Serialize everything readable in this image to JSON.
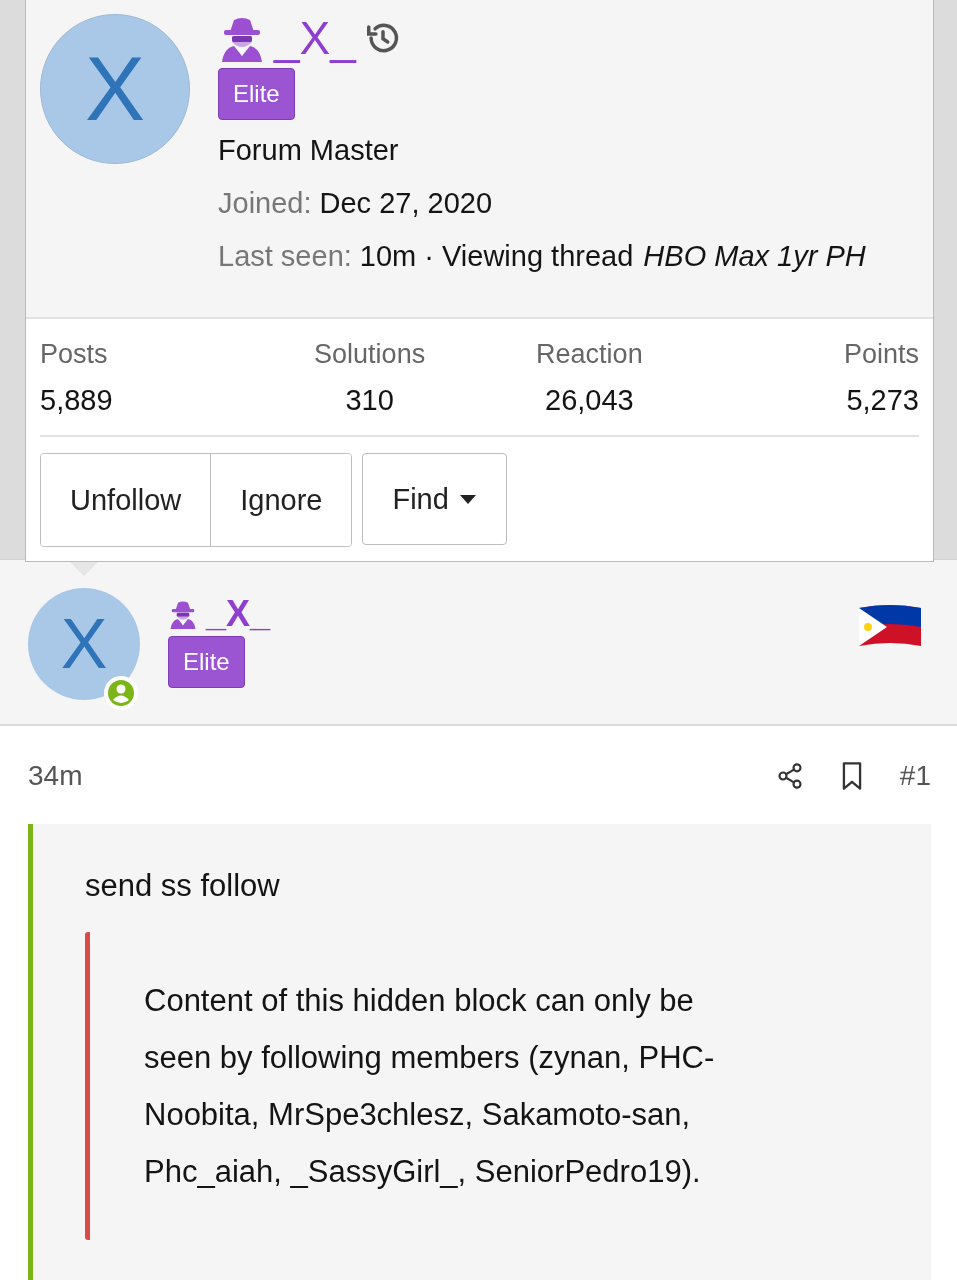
{
  "popup": {
    "avatar_letter": "X",
    "username": "_X_",
    "banner": "Elite",
    "user_title": "Forum Master",
    "joined": {
      "label": "Joined:",
      "value": "Dec 27, 2020"
    },
    "last_seen": {
      "label": "Last seen:",
      "value": "10m · Viewing thread",
      "thread": "HBO Max 1yr PH"
    },
    "stats": [
      {
        "label": "Posts",
        "value": "5,889"
      },
      {
        "label": "Solutions",
        "value": "310"
      },
      {
        "label": "Reaction",
        "value": "26,043"
      },
      {
        "label": "Points",
        "value": "5,273"
      }
    ],
    "buttons": [
      {
        "label": "Unfollow",
        "kind": "plain"
      },
      {
        "label": "Ignore",
        "kind": "plain"
      },
      {
        "label": "Find",
        "kind": "dropdown"
      }
    ]
  },
  "post": {
    "user": {
      "avatar_letter": "X",
      "username": "_X_",
      "banner": "Elite",
      "online": true
    },
    "time": "34m",
    "number": "#1",
    "message": "send ss follow",
    "hidden_block": "Content of this hidden block can only be seen by following members (zynan, PHC-Noobita, MrSpe3chlesz, Sakamoto-san, Phc_aiah, _SassyGirl_, SeniorPedro19)."
  }
}
